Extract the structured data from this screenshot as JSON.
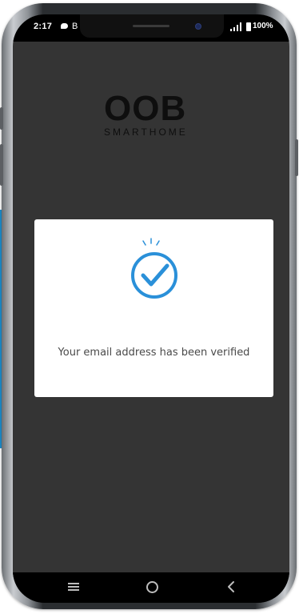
{
  "status_bar": {
    "time": "2:17",
    "notification_letter": "B",
    "battery": "100%",
    "icons": [
      "message-icon",
      "signal-icon",
      "battery-icon"
    ]
  },
  "app": {
    "logo_main": "OOB",
    "logo_sub": "SMARTHOME"
  },
  "dialog": {
    "icon": "checkmark-circle-icon",
    "message": "Your email address has been verified"
  },
  "nav_bar": {
    "icons": [
      "recents-icon",
      "home-icon",
      "back-icon"
    ]
  },
  "colors": {
    "accent": "#2a90d9",
    "overlay": "#343434",
    "dialog_bg": "#ffffff",
    "side_accent": "#1c8fd0"
  }
}
